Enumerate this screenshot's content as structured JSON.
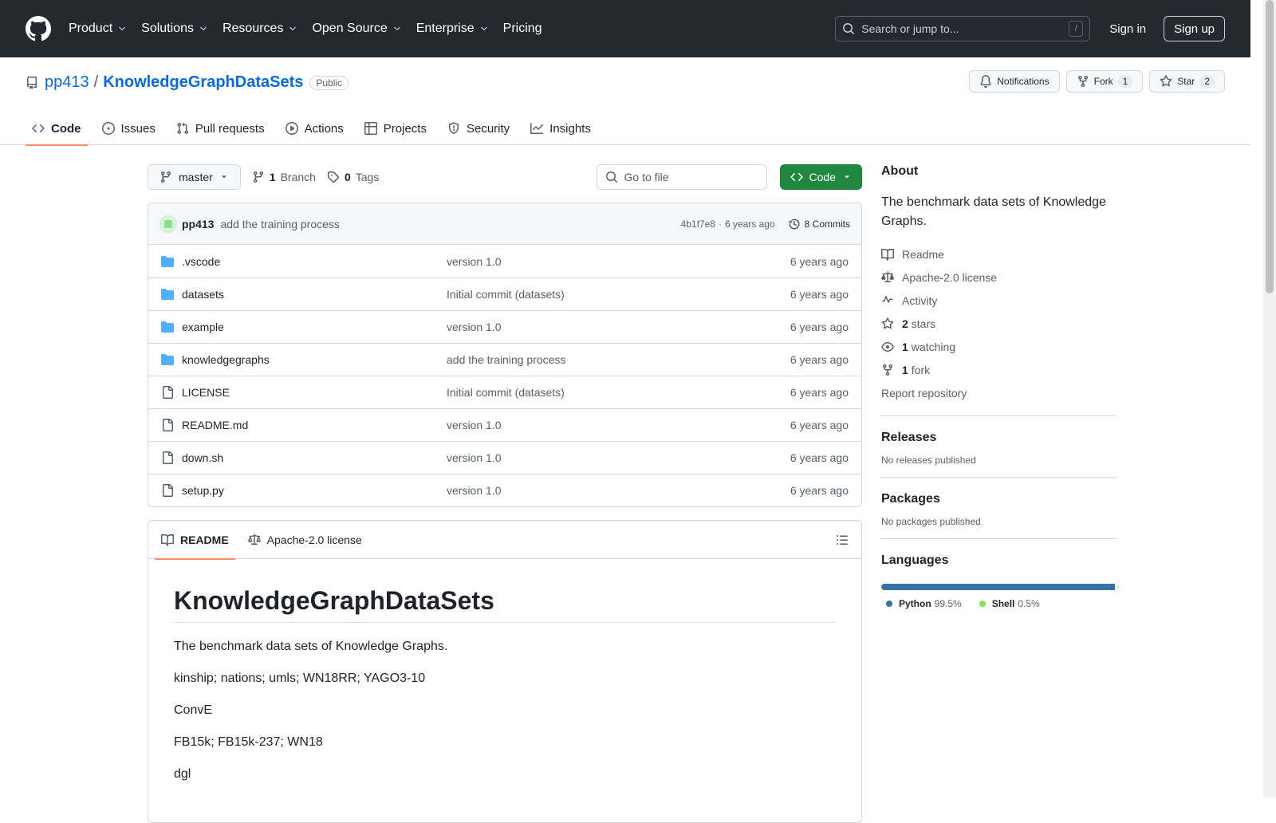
{
  "header": {
    "nav": [
      {
        "label": "Product",
        "dropdown": true
      },
      {
        "label": "Solutions",
        "dropdown": true
      },
      {
        "label": "Resources",
        "dropdown": true
      },
      {
        "label": "Open Source",
        "dropdown": true
      },
      {
        "label": "Enterprise",
        "dropdown": true
      },
      {
        "label": "Pricing",
        "dropdown": false
      }
    ],
    "search_placeholder": "Search or jump to...",
    "search_shortcut": "/",
    "sign_in": "Sign in",
    "sign_up": "Sign up"
  },
  "repo": {
    "owner": "pp413",
    "slash": "/",
    "name": "KnowledgeGraphDataSets",
    "visibility": "Public",
    "notifications_label": "Notifications",
    "fork_label": "Fork",
    "fork_count": "1",
    "star_label": "Star",
    "star_count": "2",
    "tabs": [
      {
        "label": "Code",
        "icon": "code-icon",
        "active": true
      },
      {
        "label": "Issues",
        "icon": "issue-icon",
        "active": false
      },
      {
        "label": "Pull requests",
        "icon": "pull-request-icon",
        "active": false
      },
      {
        "label": "Actions",
        "icon": "play-icon",
        "active": false
      },
      {
        "label": "Projects",
        "icon": "table-icon",
        "active": false
      },
      {
        "label": "Security",
        "icon": "shield-icon",
        "active": false
      },
      {
        "label": "Insights",
        "icon": "graph-icon",
        "active": false
      }
    ]
  },
  "toolbar": {
    "branch": "master",
    "branch_count": "1",
    "branch_label": "Branch",
    "tag_count": "0",
    "tag_label": "Tags",
    "goto_placeholder": "Go to file",
    "code_button": "Code"
  },
  "commit": {
    "author": "pp413",
    "message": "add the training process",
    "hash": "4b1f7e8",
    "separator": "·",
    "age": "6 years ago",
    "commits_label": "8 Commits"
  },
  "files": [
    {
      "name": ".vscode",
      "type": "dir",
      "message": "version 1.0",
      "age": "6 years ago"
    },
    {
      "name": "datasets",
      "type": "dir",
      "message": "Initial commit (datasets)",
      "age": "6 years ago"
    },
    {
      "name": "example",
      "type": "dir",
      "message": "version 1.0",
      "age": "6 years ago"
    },
    {
      "name": "knowledgegraphs",
      "type": "dir",
      "message": "add the training process",
      "age": "6 years ago"
    },
    {
      "name": "LICENSE",
      "type": "file",
      "message": "Initial commit (datasets)",
      "age": "6 years ago"
    },
    {
      "name": "README.md",
      "type": "file",
      "message": "version 1.0",
      "age": "6 years ago"
    },
    {
      "name": "down.sh",
      "type": "file",
      "message": "version 1.0",
      "age": "6 years ago"
    },
    {
      "name": "setup.py",
      "type": "file",
      "message": "version 1.0",
      "age": "6 years ago"
    }
  ],
  "readme": {
    "tab_readme": "README",
    "tab_license": "Apache-2.0 license",
    "title": "KnowledgeGraphDataSets",
    "paragraphs": [
      "The benchmark data sets of Knowledge Graphs.",
      "kinship; nations; umls; WN18RR; YAGO3-10",
      "ConvE",
      "FB15k; FB15k-237; WN18",
      "dgl"
    ]
  },
  "sidebar": {
    "about_title": "About",
    "description": "The benchmark data sets of Knowledge Graphs.",
    "readme": "Readme",
    "license": "Apache-2.0 license",
    "activity": "Activity",
    "stars_count": "2",
    "stars_label": "stars",
    "watching_count": "1",
    "watching_label": "watching",
    "fork_count": "1",
    "fork_label": "fork",
    "report": "Report repository",
    "releases_title": "Releases",
    "releases_text": "No releases published",
    "packages_title": "Packages",
    "packages_text": "No packages published",
    "languages_title": "Languages",
    "languages": [
      {
        "name": "Python",
        "percent": "99.5%",
        "share": 99.5,
        "color": "#3572A5"
      },
      {
        "name": "Shell",
        "percent": "0.5%",
        "share": 0.5,
        "color": "#89e051"
      }
    ]
  },
  "colors": {
    "header_bg": "#24292f",
    "link": "#0969da",
    "primary_button": "#1f883d",
    "tab_underline": "#fd8c73",
    "folder": "#54aeff"
  }
}
